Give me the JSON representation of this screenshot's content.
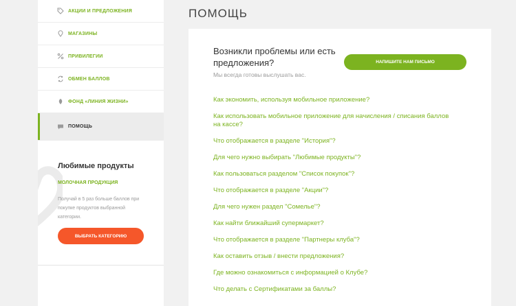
{
  "sidebar": {
    "menu": [
      {
        "label": "Акции и предложения",
        "icon": "tag-icon",
        "active": false
      },
      {
        "label": "Магазины",
        "icon": "location-pin-icon",
        "active": false
      },
      {
        "label": "Привилегии",
        "icon": "percent-icon",
        "active": false
      },
      {
        "label": "Обмен баллов",
        "icon": "exchange-icon",
        "active": false
      },
      {
        "label": "Фонд «Линия жизни»",
        "icon": "leaf-icon",
        "active": false
      },
      {
        "label": "Помощь",
        "icon": "chat-icon",
        "active": true
      }
    ],
    "favorites": {
      "title": "Любимые продукты",
      "category": "Молочная продукция",
      "description": "Получай в 5 раз больше баллов при покупке продуктов выбранной категории.",
      "button_label": "Выбрать категорию"
    }
  },
  "main": {
    "title": "ПОМОЩЬ",
    "contact": {
      "title": "Возникли проблемы или есть предложения?",
      "subtitle": "Мы всегда готовы выслушать вас.",
      "button_label": "Напишите нам письмо"
    },
    "faq": [
      "Как экономить, используя мобильное приложение?",
      "Как использовать мобильное приложение для начисления / списания баллов на кассе?",
      "Что отображается в разделе \"История\"?",
      "Для чего нужно выбирать \"Любимые продукты\"?",
      "Как пользоваться разделом \"Список покупок\"?",
      "Что отображается в разделе \"Акции\"?",
      "Для чего нужен раздел \"Сомелье\"?",
      "Как найти ближайший супермаркет?",
      "Что отображается в разделе \"Партнеры клуба\"?",
      "Как оставить отзыв / внести предложения?",
      "Где можно ознакомиться с информацией о Клубе?",
      "Что делать с Сертификатами за баллы?"
    ]
  },
  "colors": {
    "accent_green": "#7cb320",
    "accent_orange": "#f5572a",
    "page_bg": "#f1f1f1",
    "text_dark": "#333333",
    "text_muted": "#9a9a9a"
  }
}
